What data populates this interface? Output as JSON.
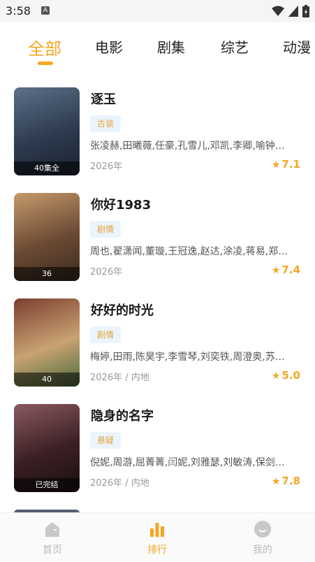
{
  "status": {
    "time": "3:58",
    "notification_glyph": "A"
  },
  "tabs": [
    {
      "label": "全部",
      "active": true
    },
    {
      "label": "电影"
    },
    {
      "label": "剧集"
    },
    {
      "label": "综艺"
    },
    {
      "label": "动漫"
    }
  ],
  "items": [
    {
      "title": "逐玉",
      "genre": "古装",
      "cast": "张凌赫,田曦薇,任豪,孔雪儿,邓凯,李卿,喻钟…",
      "meta": "2026年",
      "rating": "7.1",
      "poster_caption": "40集全",
      "poster_colors": [
        "#2d3b4f",
        "#5c7088",
        "#1a2230"
      ]
    },
    {
      "title": "你好1983",
      "genre": "剧情",
      "cast": "周也,翟潇闻,董璇,王冠逸,赵达,涂凌,蒋易,郑…",
      "meta": "2026年",
      "rating": "7.4",
      "poster_caption": "36",
      "poster_colors": [
        "#6b4a33",
        "#c79a6c",
        "#3b2a1e"
      ]
    },
    {
      "title": "好好的时光",
      "genre": "剧情",
      "cast": "梅婷,田雨,陈昊宇,李雪琴,刘奕铁,周澄奥,苏…",
      "meta": "2026年 / 内地",
      "rating": "5.0",
      "poster_caption": "40",
      "poster_colors": [
        "#c9a273",
        "#7b3f2f",
        "#4a6b3a"
      ]
    },
    {
      "title": "隐身的名字",
      "genre": "悬疑",
      "cast": "倪妮,周游,屈菁菁,闫妮,刘雅瑟,刘敏涛,保剑…",
      "meta": "2026年 / 内地",
      "rating": "7.8",
      "poster_caption": "已完结",
      "poster_colors": [
        "#3a1f24",
        "#8a5a5e",
        "#1c1012"
      ]
    }
  ],
  "nav": [
    {
      "label": "首页",
      "icon": "home-icon"
    },
    {
      "label": "排行",
      "icon": "ranking-icon",
      "active": true
    },
    {
      "label": "我的",
      "icon": "profile-icon"
    }
  ],
  "colors": {
    "accent": "#f5a623",
    "genre_bg": "#eaf4fc"
  }
}
